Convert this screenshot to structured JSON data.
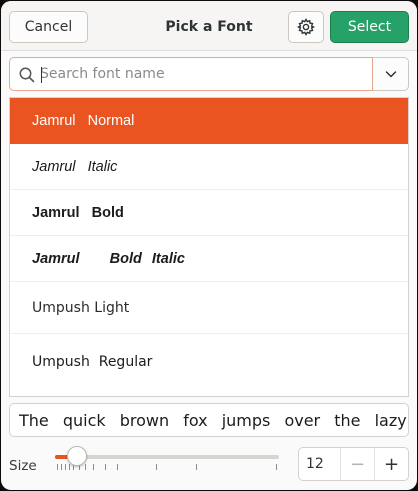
{
  "header": {
    "cancel_label": "Cancel",
    "title": "Pick a Font",
    "settings_icon": "gear-icon",
    "select_label": "Select"
  },
  "search": {
    "placeholder": "Search font name",
    "value": "",
    "icon": "search-icon",
    "dropdown_icon": "chevron-down-icon"
  },
  "fonts": [
    {
      "family": "Jamrul",
      "face": "Normal",
      "selected": true
    },
    {
      "family": "Jamrul",
      "face": "Italic",
      "selected": false
    },
    {
      "family": "Jamrul",
      "face": "Bold",
      "selected": false
    },
    {
      "family": "Jamrul",
      "face": "Bold Italic",
      "selected": false
    },
    {
      "family": "Umpush",
      "face": "Light",
      "selected": false
    },
    {
      "family": "Umpush",
      "face": "Regular",
      "selected": false
    }
  ],
  "preview": {
    "text": "The quick brown fox jumps over the lazy"
  },
  "size": {
    "label": "Size",
    "value": "12",
    "slider_fraction": 0.08,
    "minus_symbol": "−",
    "plus_symbol": "+"
  },
  "colors": {
    "accent": "#e95420",
    "select_button": "#26a269"
  }
}
